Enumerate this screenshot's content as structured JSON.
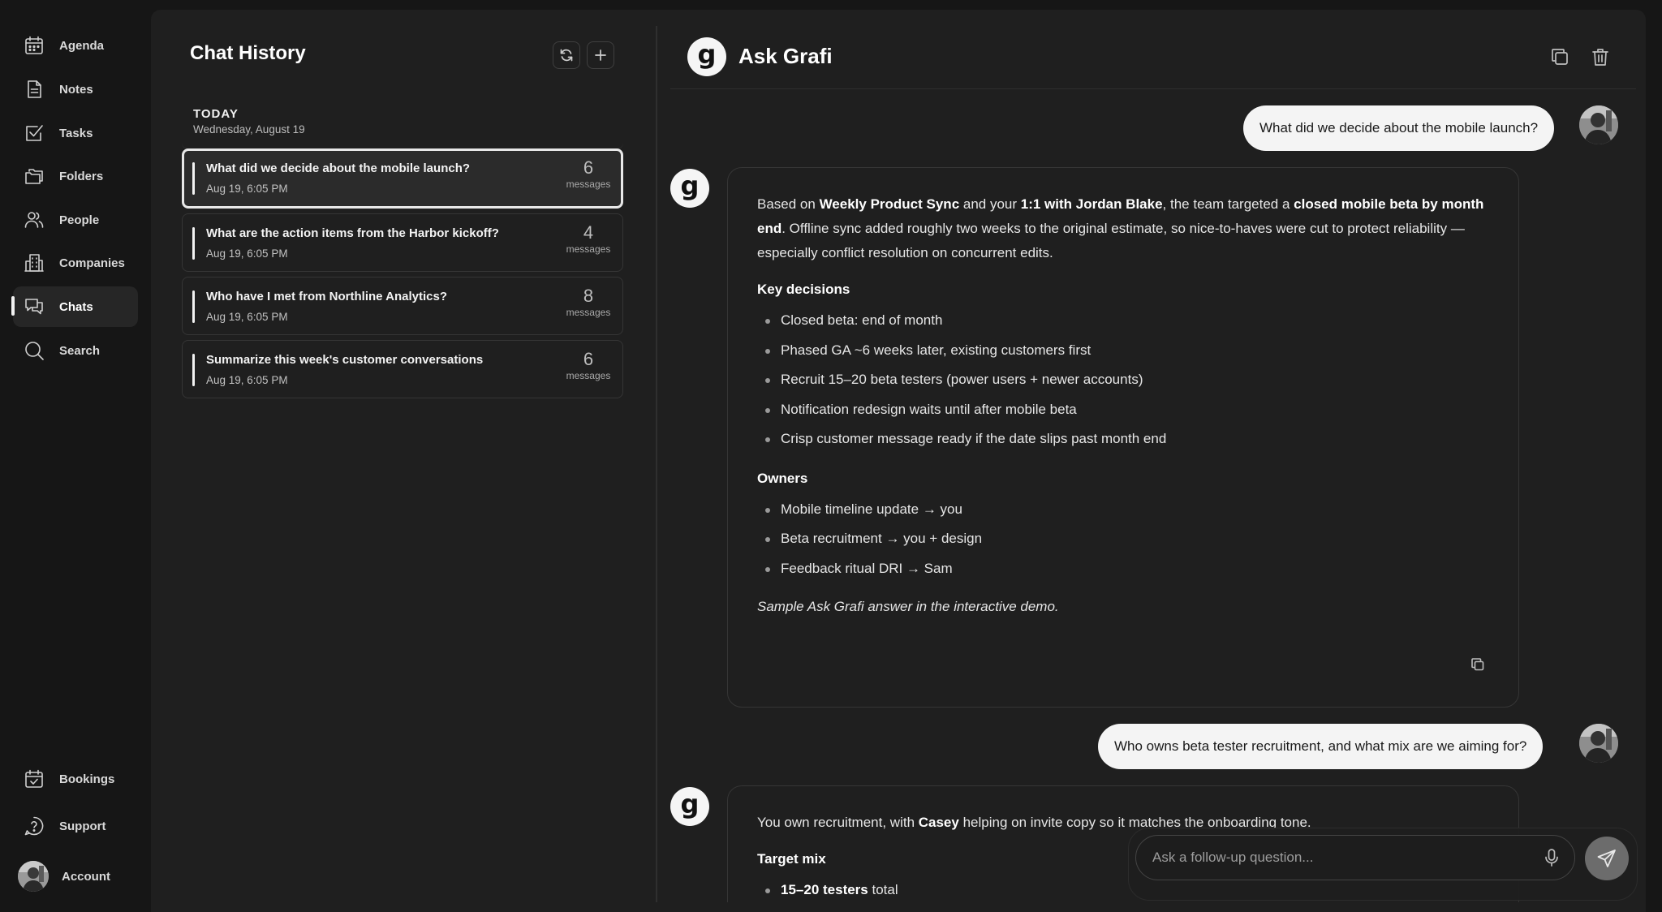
{
  "nav": {
    "items": [
      {
        "label": "Agenda",
        "icon": "calendar-icon"
      },
      {
        "label": "Notes",
        "icon": "note-icon"
      },
      {
        "label": "Tasks",
        "icon": "checkbox-icon"
      },
      {
        "label": "Folders",
        "icon": "folders-icon"
      },
      {
        "label": "People",
        "icon": "people-icon"
      },
      {
        "label": "Companies",
        "icon": "building-icon"
      },
      {
        "label": "Chats",
        "icon": "chat-bubbles-icon"
      },
      {
        "label": "Search",
        "icon": "search-icon"
      }
    ],
    "active": "Chats",
    "bottom": [
      {
        "label": "Bookings",
        "icon": "calendar-check-icon"
      },
      {
        "label": "Support",
        "icon": "help-circle-icon"
      },
      {
        "label": "Account",
        "icon": "avatar"
      }
    ]
  },
  "history": {
    "title": "Chat History",
    "group_title": "TODAY",
    "group_date": "Wednesday, August 19",
    "chats": [
      {
        "title": "What did we decide about the mobile launch?",
        "time": "Aug 19, 6:05 PM",
        "count": "6",
        "count_label": "messages",
        "selected": true
      },
      {
        "title": "What are the action items from the Harbor kickoff?",
        "time": "Aug 19, 6:05 PM",
        "count": "4",
        "count_label": "messages"
      },
      {
        "title": "Who have I met from Northline Analytics?",
        "time": "Aug 19, 6:05 PM",
        "count": "8",
        "count_label": "messages"
      },
      {
        "title": "Summarize this week's customer conversations",
        "time": "Aug 19, 6:05 PM",
        "count": "6",
        "count_label": "messages"
      }
    ]
  },
  "ask": {
    "logo_letter": "g",
    "title": "Ask Grafi",
    "messages": {
      "q1": "What did we decide about the mobile launch?",
      "a1": {
        "p_1": "Based on ",
        "b_1": "Weekly Product Sync",
        "p_2": " and your ",
        "b_2": "1:1 with Jordan Blake",
        "p_3": ", the team targeted a ",
        "b_3": "closed mobile beta by month end",
        "p_4": ". Offline sync added roughly two weeks to the original estimate, so nice-to-haves were cut to protect reliability — especially conflict resolution on concurrent edits.",
        "h_decisions": "Key decisions",
        "decisions": [
          "Closed beta: end of month",
          "Phased GA ~6 weeks later, existing customers first",
          "Recruit 15–20 beta testers (power users + newer accounts)",
          "Notification redesign waits until after mobile beta",
          "Crisp customer message ready if the date slips past month end"
        ],
        "h_owners": "Owners",
        "owners": [
          "Mobile timeline update → you",
          "Beta recruitment → you + design",
          "Feedback ritual DRI → Sam"
        ],
        "note": "Sample Ask Grafi answer in the interactive demo."
      },
      "q2": "Who owns beta tester recruitment, and what mix are we aiming for?",
      "a2": {
        "p_1": "You own recruitment, with ",
        "b_1": "Casey",
        "p_2": " helping on invite copy so it matches the onboarding tone.",
        "h_mix": "Target mix",
        "mix_b": "15–20 testers",
        "mix_rest": " total"
      }
    },
    "composer_placeholder": "Ask a follow-up question..."
  }
}
